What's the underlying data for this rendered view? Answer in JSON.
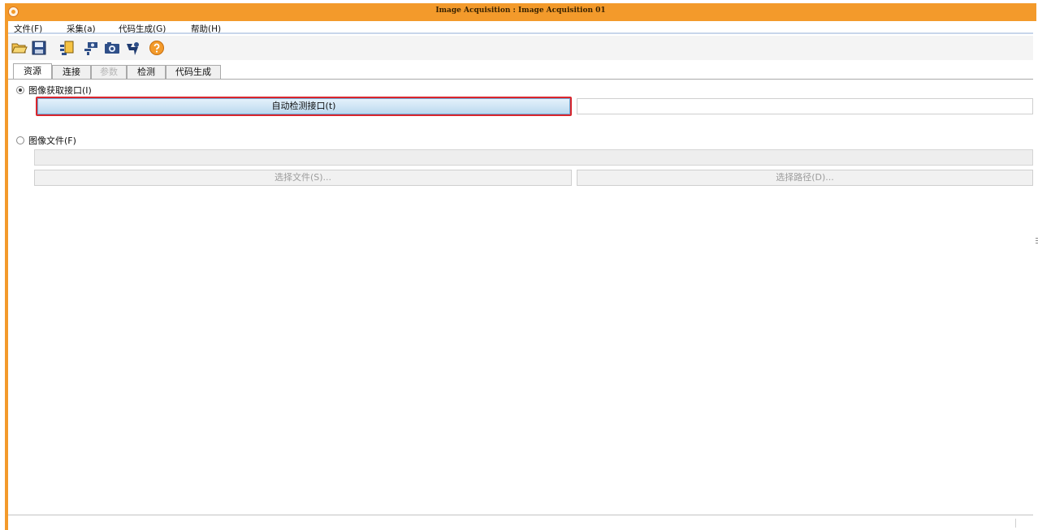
{
  "window": {
    "title": "Image Acquisition : Image Acquisition 01",
    "accent_color": "#f39a2b"
  },
  "menubar": {
    "items": [
      {
        "label": "文件(F)"
      },
      {
        "label": "采集(a)"
      },
      {
        "label": "代码生成(G)"
      },
      {
        "label": "帮助(H)"
      }
    ]
  },
  "toolbar": {
    "buttons": [
      {
        "icon": "open-folder-icon"
      },
      {
        "icon": "save-icon"
      },
      {
        "icon": "properties-icon"
      },
      {
        "icon": "connect-icon"
      },
      {
        "icon": "camera-icon"
      },
      {
        "icon": "live-icon"
      },
      {
        "icon": "help-icon"
      }
    ]
  },
  "tabs": [
    {
      "label": "资源",
      "state": "active"
    },
    {
      "label": "连接",
      "state": "normal"
    },
    {
      "label": "参数",
      "state": "disabled"
    },
    {
      "label": "检测",
      "state": "normal"
    },
    {
      "label": "代码生成",
      "state": "normal"
    }
  ],
  "source": {
    "interface_option": {
      "label": "图像获取接口(I)",
      "checked": true,
      "auto_detect_button": "自动检测接口(t)",
      "interface_value": ""
    },
    "file_option": {
      "label": "图像文件(F)",
      "checked": false,
      "path_value": "",
      "select_files_button": "选择文件(S)...",
      "select_path_button": "选择路径(D)..."
    }
  },
  "annotation": {
    "highlight_color": "#d9262d"
  }
}
